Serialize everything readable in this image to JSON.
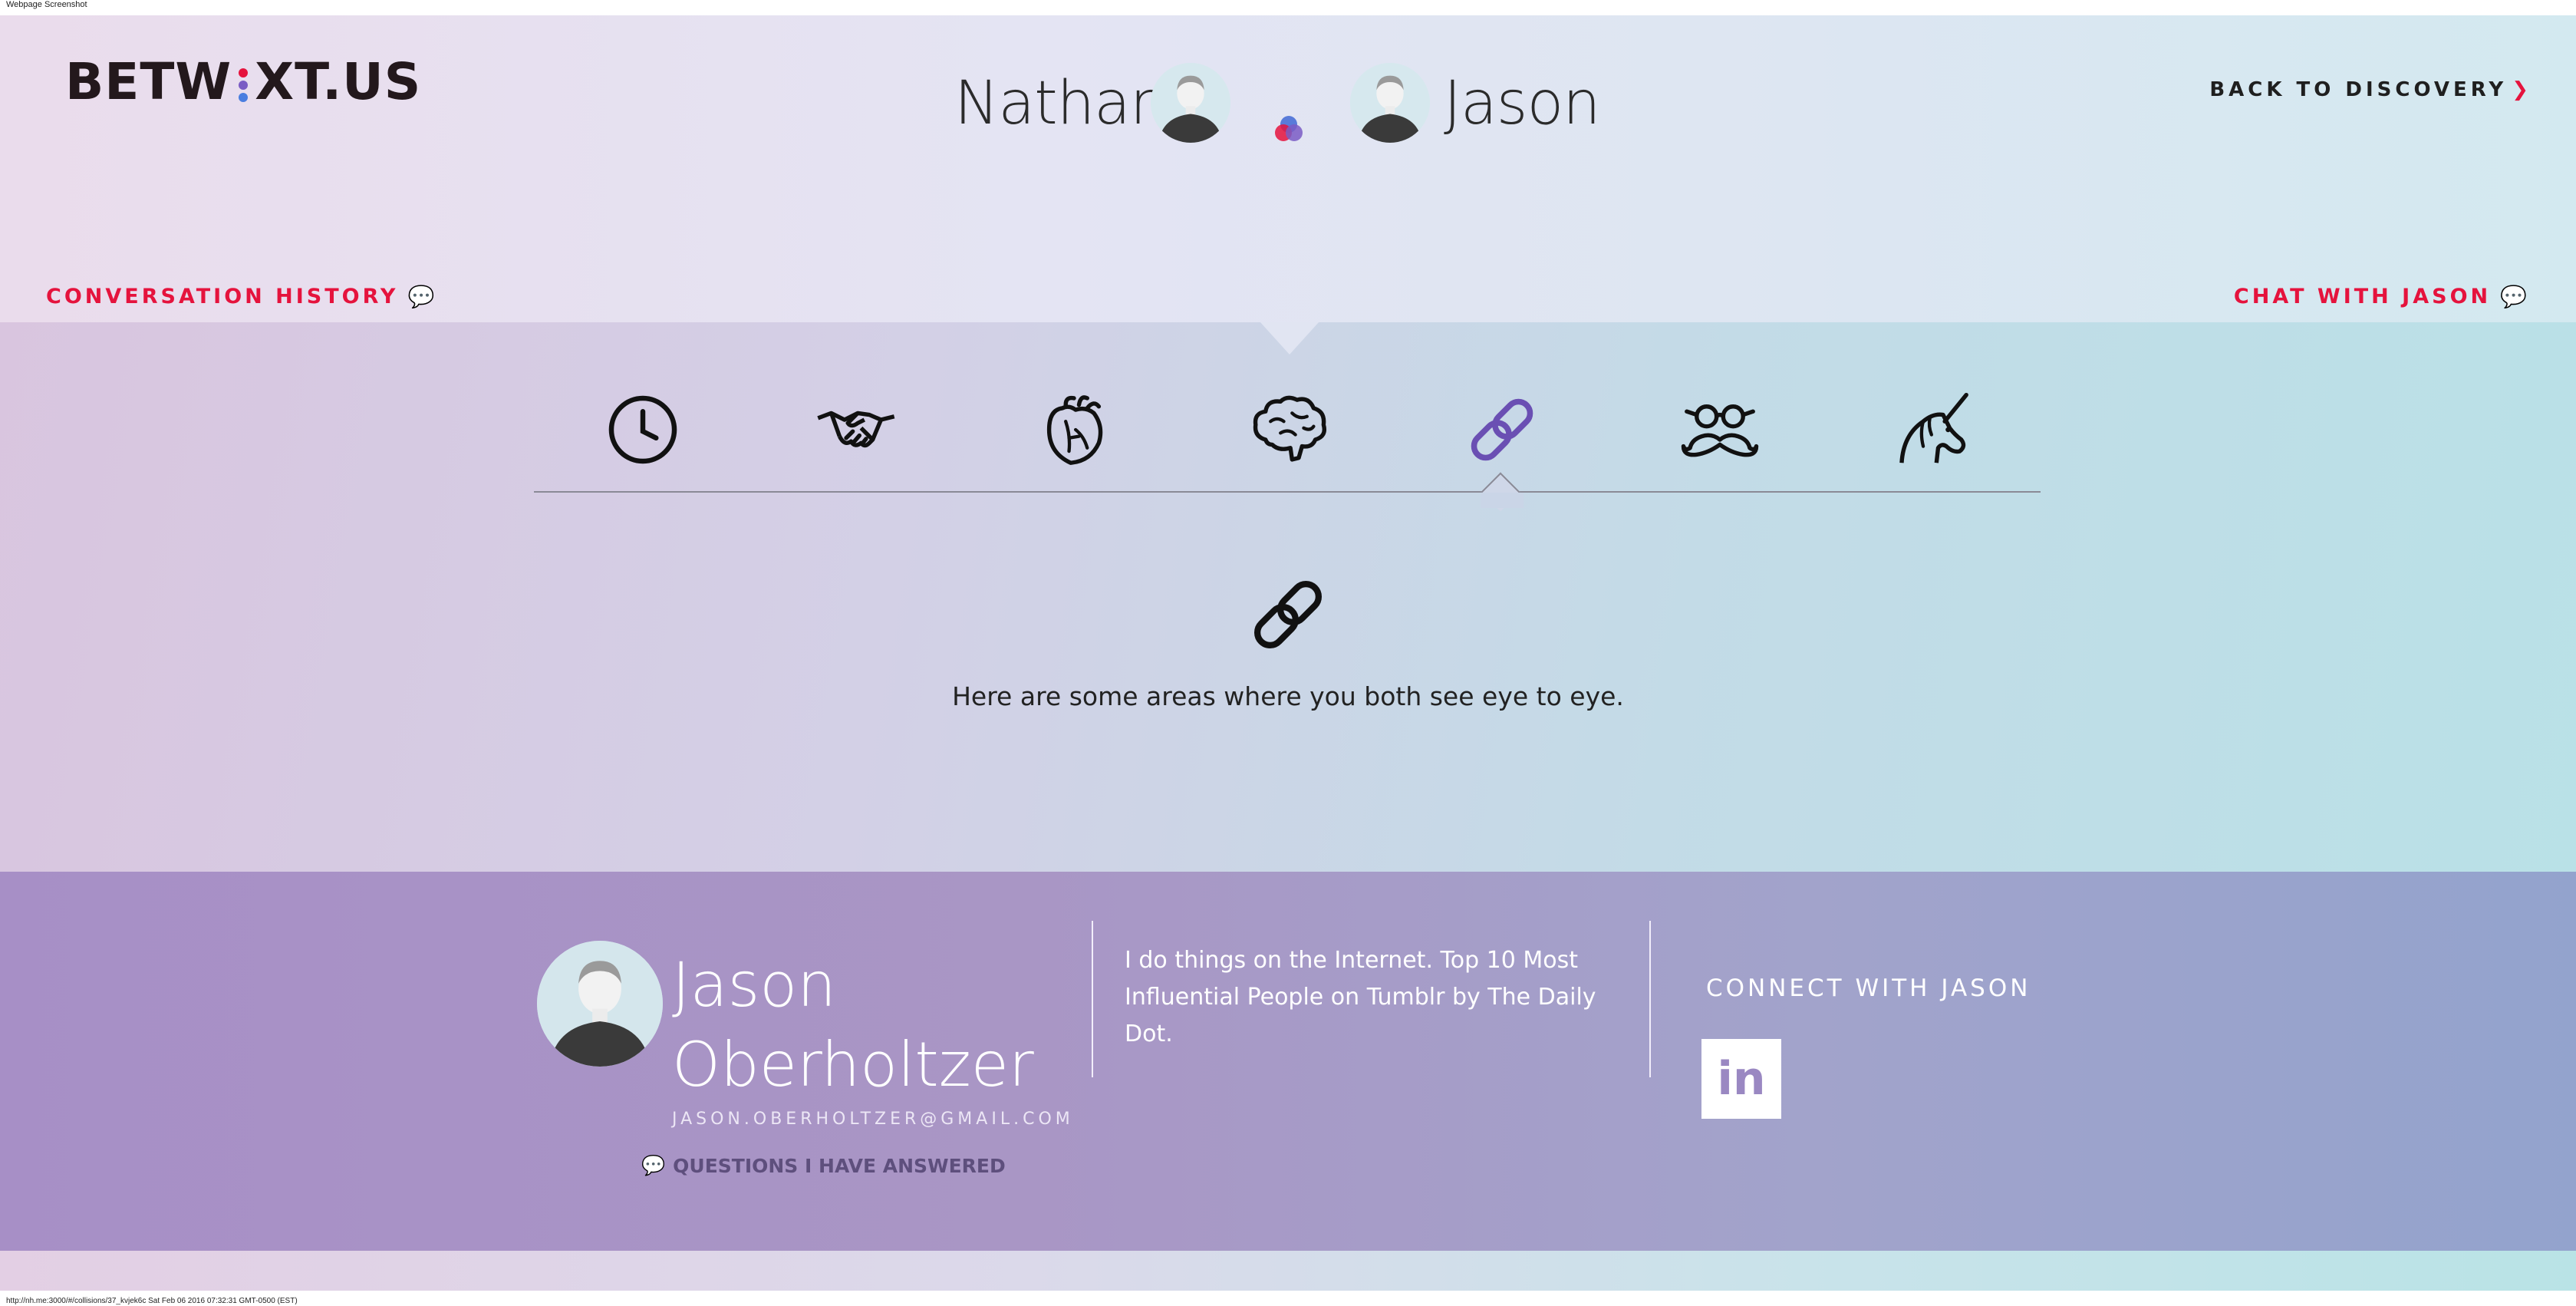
{
  "browser": {
    "caption": "Webpage Screenshot",
    "url_line": "http://nh.me:3000/#/collisions/37_kvjek6c Sat Feb 06 2016 07:32:31 GMT-0500 (EST)"
  },
  "header": {
    "logo_left": "BETW",
    "logo_right": "XT.US",
    "person_left": "Nathan",
    "person_right": "Jason",
    "back_link": "BACK TO DISCOVERY",
    "conversation_history": "CONVERSATION HISTORY",
    "chat_link": "CHAT WITH JASON"
  },
  "tabs": [
    {
      "icon": "clock-icon",
      "active": false
    },
    {
      "icon": "handshake-icon",
      "active": false
    },
    {
      "icon": "heart-icon",
      "active": false
    },
    {
      "icon": "brain-icon",
      "active": false
    },
    {
      "icon": "chain-link-icon",
      "active": true
    },
    {
      "icon": "mustache-glasses-icon",
      "active": false
    },
    {
      "icon": "unicorn-icon",
      "active": false
    }
  ],
  "detail": {
    "icon": "chain-link-icon",
    "text": "Here are some areas where you both see eye to eye."
  },
  "profile": {
    "first_name": "Jason",
    "last_name": "Oberholtzer",
    "email": "JASON.OBERHOLTZER@GMAIL.COM",
    "questions_link": "QUESTIONS I HAVE ANSWERED",
    "bio": "I do things on the Internet. Top 10 Most Influential People on Tumblr by The Daily Dot.",
    "connect_heading": "CONNECT WITH JASON",
    "linkedin_label": "in"
  },
  "colors": {
    "accent_red": "#e5133d",
    "active_tab": "#6a4fb3",
    "profile_bg": "#a996c5"
  }
}
